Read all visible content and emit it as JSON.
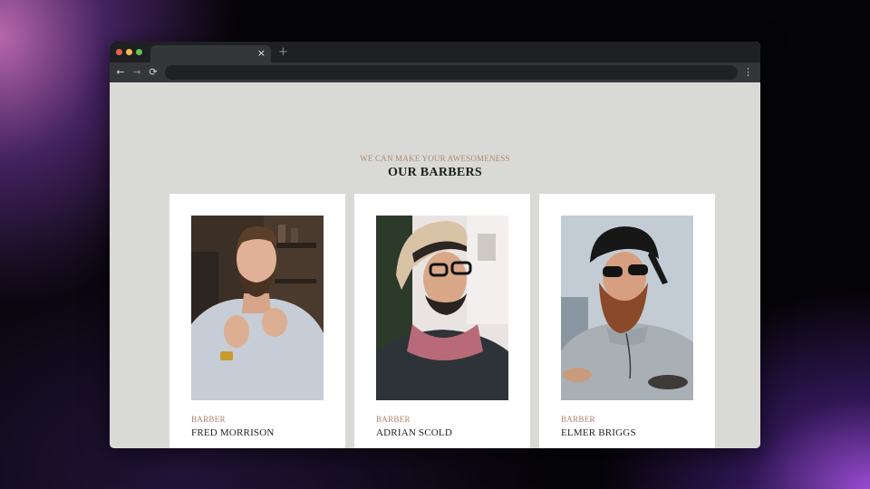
{
  "browser": {
    "tab_close": "×",
    "new_tab": "+",
    "nav": {
      "back": "←",
      "forward": "→",
      "reload": "⟳",
      "menu": "⋮"
    },
    "address_value": ""
  },
  "section": {
    "eyebrow": "WE CAN MAKE YOUR AWESOMENESS",
    "title": "OUR BARBERS"
  },
  "barbers": [
    {
      "role": "BARBER",
      "name": "FRED MORRISON",
      "photo": "barber-portrait-fred-morrison"
    },
    {
      "role": "BARBER",
      "name": "ADRIAN SCOLD",
      "photo": "barber-portrait-adrian-scold"
    },
    {
      "role": "BARBER",
      "name": "ELMER BRIGGS",
      "photo": "barber-portrait-elmer-briggs"
    }
  ],
  "colors": {
    "page_background": "#d9dad6",
    "accent": "#b0806a",
    "card_background": "#ffffff",
    "heading": "#1e1e1e"
  }
}
